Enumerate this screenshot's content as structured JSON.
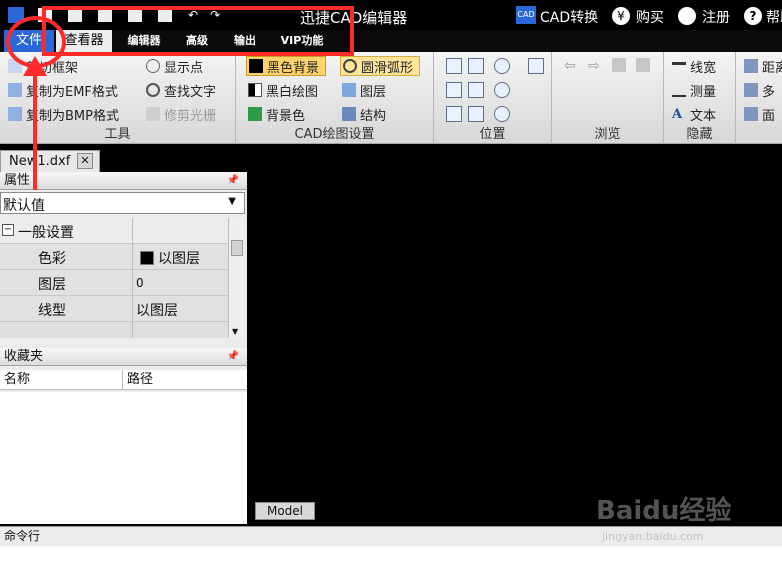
{
  "title_bar": {
    "app_title": "迅捷CAD编辑器",
    "cad_convert": "CAD转换",
    "buy": "购买",
    "register": "注册",
    "help": "帮助",
    "cad_badge": "CAD"
  },
  "menu": {
    "items": [
      "文件",
      "查看器",
      "编辑器",
      "高级",
      "输出",
      "VIP功能"
    ]
  },
  "ribbon": {
    "tools": {
      "title": "工具",
      "items": [
        "剪切框架",
        "复制为EMF格式",
        "复制为BMP格式",
        "显示点",
        "查找文字",
        "修剪光栅"
      ]
    },
    "cad_settings": {
      "title": "CAD绘图设置",
      "items": [
        "黑色背景",
        "黑白绘图",
        "背景色",
        "圆滑弧形",
        "图层",
        "结构"
      ]
    },
    "position": {
      "title": "位置"
    },
    "browse": {
      "title": "浏览"
    },
    "hide": {
      "title": "隐藏",
      "items": [
        "线宽",
        "测量",
        "文本"
      ]
    },
    "extra": {
      "items": [
        "距离",
        "多",
        "面"
      ]
    }
  },
  "document_tab": {
    "label": "New1.dxf",
    "close": "✕"
  },
  "properties": {
    "header": "属性",
    "preset": "默认值",
    "section": "一般设置",
    "rows": [
      {
        "label": "色彩",
        "value": "以图层"
      },
      {
        "label": "图层",
        "value": "0"
      },
      {
        "label": "线型",
        "value": "以图层"
      }
    ]
  },
  "favorites": {
    "header": "收藏夹",
    "columns": [
      "名称",
      "路径"
    ]
  },
  "canvas": {
    "model_tab": "Model"
  },
  "command_line": {
    "label": "命令行"
  },
  "colors": {
    "accent": "#ff2b2b",
    "menu_active": "#2a67d8",
    "canvas": "#000000"
  },
  "watermark": {
    "text": "Baidu经验",
    "sub": "jingyan.baidu.com"
  }
}
